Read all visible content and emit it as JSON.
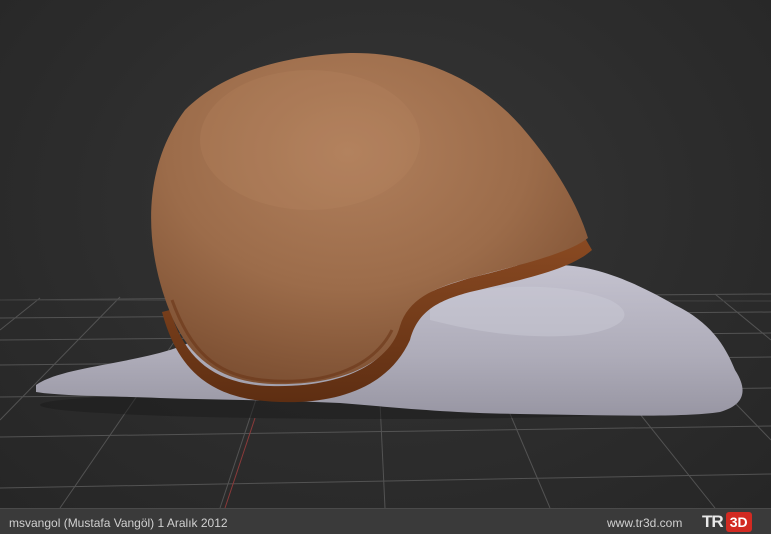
{
  "footer": {
    "credit": "msvangol (Mustafa Vangöl)  1 Aralık 2012",
    "site_url": "www.tr3d.com",
    "logo_left": "TR",
    "logo_right": "3D"
  },
  "colors": {
    "background": "#2a2a2a",
    "grid_line": "#5a5a5a",
    "shell": "#a07050",
    "shell_rim": "#7a3e1c",
    "body": "#b8b6c2",
    "logo_accent": "#d22a22"
  }
}
